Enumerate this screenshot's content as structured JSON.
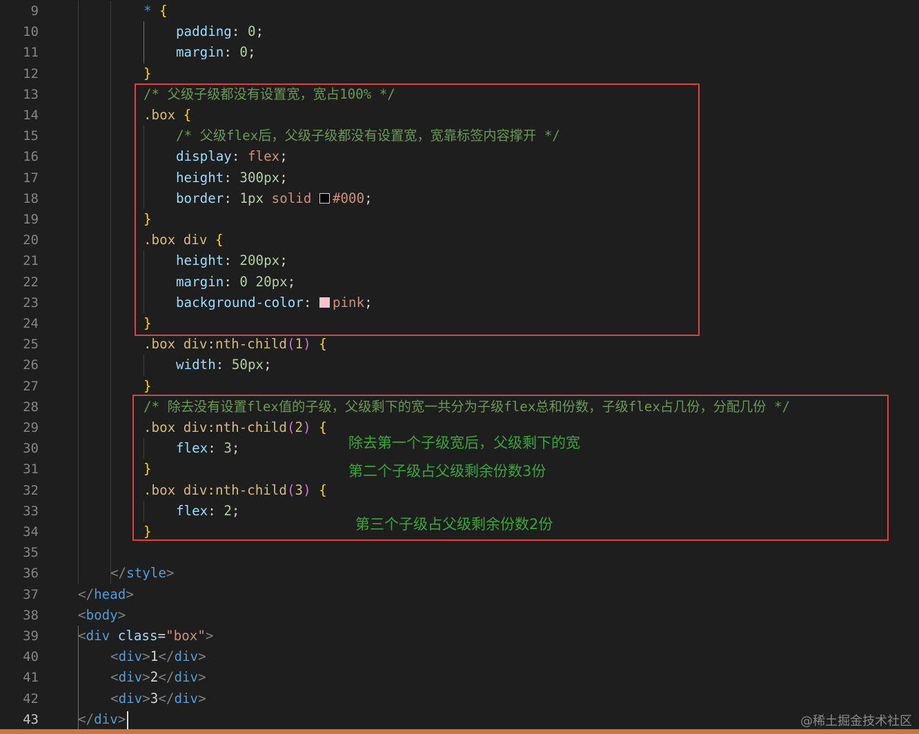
{
  "editor": {
    "active_line": "43",
    "lines": [
      {
        "n": "9",
        "indent": 208,
        "tokens": [
          {
            "t": "* ",
            "c": "star"
          },
          {
            "t": "{",
            "c": "brace"
          }
        ]
      },
      {
        "n": "10",
        "indent": 255,
        "tokens": [
          {
            "t": "padding",
            "c": "prop"
          },
          {
            "t": ": ",
            "c": "plain"
          },
          {
            "t": "0",
            "c": "num"
          },
          {
            "t": ";",
            "c": "plain"
          }
        ]
      },
      {
        "n": "11",
        "indent": 255,
        "tokens": [
          {
            "t": "margin",
            "c": "prop"
          },
          {
            "t": ": ",
            "c": "plain"
          },
          {
            "t": "0",
            "c": "num"
          },
          {
            "t": ";",
            "c": "plain"
          }
        ]
      },
      {
        "n": "12",
        "indent": 208,
        "tokens": [
          {
            "t": "}",
            "c": "brace"
          }
        ]
      },
      {
        "n": "13",
        "indent": 208,
        "tokens": [
          {
            "t": "/* 父级子级都没有设置宽，宽占100% */",
            "c": "cmt"
          }
        ]
      },
      {
        "n": "14",
        "indent": 208,
        "tokens": [
          {
            "t": ".box ",
            "c": "sel"
          },
          {
            "t": "{",
            "c": "brace"
          }
        ]
      },
      {
        "n": "15",
        "indent": 255,
        "tokens": [
          {
            "t": "/* 父级flex后，父级子级都没有设置宽，宽靠标签内容撑开 */",
            "c": "cmt"
          }
        ]
      },
      {
        "n": "16",
        "indent": 255,
        "tokens": [
          {
            "t": "display",
            "c": "prop"
          },
          {
            "t": ": ",
            "c": "plain"
          },
          {
            "t": "flex",
            "c": "val"
          },
          {
            "t": ";",
            "c": "plain"
          }
        ]
      },
      {
        "n": "17",
        "indent": 255,
        "tokens": [
          {
            "t": "height",
            "c": "prop"
          },
          {
            "t": ": ",
            "c": "plain"
          },
          {
            "t": "300px",
            "c": "num"
          },
          {
            "t": ";",
            "c": "plain"
          }
        ]
      },
      {
        "n": "18",
        "indent": 255,
        "tokens": [
          {
            "t": "border",
            "c": "prop"
          },
          {
            "t": ": ",
            "c": "plain"
          },
          {
            "t": "1px ",
            "c": "num"
          },
          {
            "t": "solid ",
            "c": "val"
          },
          {
            "swatch": "#000000"
          },
          {
            "t": "#000",
            "c": "val"
          },
          {
            "t": ";",
            "c": "plain"
          }
        ]
      },
      {
        "n": "19",
        "indent": 208,
        "tokens": [
          {
            "t": "}",
            "c": "brace"
          }
        ]
      },
      {
        "n": "20",
        "indent": 208,
        "tokens": [
          {
            "t": ".box div ",
            "c": "sel"
          },
          {
            "t": "{",
            "c": "brace"
          }
        ]
      },
      {
        "n": "21",
        "indent": 255,
        "tokens": [
          {
            "t": "height",
            "c": "prop"
          },
          {
            "t": ": ",
            "c": "plain"
          },
          {
            "t": "200px",
            "c": "num"
          },
          {
            "t": ";",
            "c": "plain"
          }
        ]
      },
      {
        "n": "22",
        "indent": 255,
        "tokens": [
          {
            "t": "margin",
            "c": "prop"
          },
          {
            "t": ": ",
            "c": "plain"
          },
          {
            "t": "0 20px",
            "c": "num"
          },
          {
            "t": ";",
            "c": "plain"
          }
        ]
      },
      {
        "n": "23",
        "indent": 255,
        "tokens": [
          {
            "t": "background-color",
            "c": "prop"
          },
          {
            "t": ": ",
            "c": "plain"
          },
          {
            "swatch": "#ffc0cb"
          },
          {
            "t": "pink",
            "c": "val"
          },
          {
            "t": ";",
            "c": "plain"
          }
        ]
      },
      {
        "n": "24",
        "indent": 208,
        "tokens": [
          {
            "t": "}",
            "c": "brace"
          }
        ]
      },
      {
        "n": "25",
        "indent": 208,
        "tokens": [
          {
            "t": ".box div:nth-child",
            "c": "sel"
          },
          {
            "t": "(",
            "c": "paren"
          },
          {
            "t": "1",
            "c": "sel"
          },
          {
            "t": ")",
            "c": "paren"
          },
          {
            "t": " ",
            "c": "plain"
          },
          {
            "t": "{",
            "c": "brace"
          }
        ]
      },
      {
        "n": "26",
        "indent": 255,
        "tokens": [
          {
            "t": "width",
            "c": "prop"
          },
          {
            "t": ": ",
            "c": "plain"
          },
          {
            "t": "50px",
            "c": "num"
          },
          {
            "t": ";",
            "c": "plain"
          }
        ]
      },
      {
        "n": "27",
        "indent": 208,
        "tokens": [
          {
            "t": "}",
            "c": "brace"
          }
        ]
      },
      {
        "n": "28",
        "indent": 208,
        "tokens": [
          {
            "t": "/* 除去没有设置flex值的子级，父级剩下的宽一共分为子级flex总和份数，子级flex占几份，分配几份 */",
            "c": "cmt"
          }
        ]
      },
      {
        "n": "29",
        "indent": 208,
        "tokens": [
          {
            "t": ".box div:nth-child",
            "c": "sel"
          },
          {
            "t": "(",
            "c": "paren"
          },
          {
            "t": "2",
            "c": "sel"
          },
          {
            "t": ")",
            "c": "paren"
          },
          {
            "t": " ",
            "c": "plain"
          },
          {
            "t": "{",
            "c": "brace"
          }
        ]
      },
      {
        "n": "30",
        "indent": 255,
        "tokens": [
          {
            "t": "flex",
            "c": "prop"
          },
          {
            "t": ": ",
            "c": "plain"
          },
          {
            "t": "3",
            "c": "num"
          },
          {
            "t": ";",
            "c": "plain"
          }
        ]
      },
      {
        "n": "31",
        "indent": 208,
        "tokens": [
          {
            "t": "}",
            "c": "brace"
          }
        ]
      },
      {
        "n": "32",
        "indent": 208,
        "tokens": [
          {
            "t": ".box div:nth-child",
            "c": "sel"
          },
          {
            "t": "(",
            "c": "paren"
          },
          {
            "t": "3",
            "c": "sel"
          },
          {
            "t": ")",
            "c": "paren"
          },
          {
            "t": " ",
            "c": "plain"
          },
          {
            "t": "{",
            "c": "brace"
          }
        ]
      },
      {
        "n": "33",
        "indent": 255,
        "tokens": [
          {
            "t": "flex",
            "c": "prop"
          },
          {
            "t": ": ",
            "c": "plain"
          },
          {
            "t": "2",
            "c": "num"
          },
          {
            "t": ";",
            "c": "plain"
          }
        ]
      },
      {
        "n": "34",
        "indent": 208,
        "tokens": [
          {
            "t": "}",
            "c": "brace"
          }
        ]
      },
      {
        "n": "35",
        "indent": 208,
        "tokens": []
      },
      {
        "n": "36",
        "indent": 160,
        "tokens": [
          {
            "t": "</",
            "c": "tagp"
          },
          {
            "t": "style",
            "c": "tag"
          },
          {
            "t": ">",
            "c": "tagp"
          }
        ]
      },
      {
        "n": "37",
        "indent": 113,
        "tokens": [
          {
            "t": "</",
            "c": "tagp"
          },
          {
            "t": "head",
            "c": "tag"
          },
          {
            "t": ">",
            "c": "tagp"
          }
        ]
      },
      {
        "n": "38",
        "indent": 113,
        "tokens": [
          {
            "t": "<",
            "c": "tagp"
          },
          {
            "t": "body",
            "c": "tag"
          },
          {
            "t": ">",
            "c": "tagp"
          }
        ]
      },
      {
        "n": "39",
        "indent": 113,
        "tokens": [
          {
            "t": "<",
            "c": "tagp"
          },
          {
            "t": "div ",
            "c": "tag"
          },
          {
            "t": "class",
            "c": "attr"
          },
          {
            "t": "=",
            "c": "plain"
          },
          {
            "t": "\"box\"",
            "c": "str"
          },
          {
            "t": ">",
            "c": "tagp"
          }
        ]
      },
      {
        "n": "40",
        "indent": 160,
        "tokens": [
          {
            "t": "<",
            "c": "tagp"
          },
          {
            "t": "div",
            "c": "tag"
          },
          {
            "t": ">",
            "c": "tagp"
          },
          {
            "t": "1",
            "c": "plain"
          },
          {
            "t": "</",
            "c": "tagp"
          },
          {
            "t": "div",
            "c": "tag"
          },
          {
            "t": ">",
            "c": "tagp"
          }
        ]
      },
      {
        "n": "41",
        "indent": 160,
        "tokens": [
          {
            "t": "<",
            "c": "tagp"
          },
          {
            "t": "div",
            "c": "tag"
          },
          {
            "t": ">",
            "c": "tagp"
          },
          {
            "t": "2",
            "c": "plain"
          },
          {
            "t": "</",
            "c": "tagp"
          },
          {
            "t": "div",
            "c": "tag"
          },
          {
            "t": ">",
            "c": "tagp"
          }
        ]
      },
      {
        "n": "42",
        "indent": 160,
        "tokens": [
          {
            "t": "<",
            "c": "tagp"
          },
          {
            "t": "div",
            "c": "tag"
          },
          {
            "t": ">",
            "c": "tagp"
          },
          {
            "t": "3",
            "c": "plain"
          },
          {
            "t": "</",
            "c": "tagp"
          },
          {
            "t": "div",
            "c": "tag"
          },
          {
            "t": ">",
            "c": "tagp"
          }
        ]
      },
      {
        "n": "43",
        "indent": 113,
        "tokens": [
          {
            "t": "</",
            "c": "tagp"
          },
          {
            "t": "div",
            "c": "tag"
          },
          {
            "t": ">",
            "c": "tagp"
          }
        ]
      }
    ]
  },
  "annotations": {
    "note1": "除去第一个子级宽后，父级剩下的宽",
    "note2": "第二个子级占父级剩余份数3份",
    "note3": "第三个子级占父级剩余份数2份",
    "box_color": "#e04040",
    "note_color": "#3aa63a"
  },
  "watermark": "@稀土掘金技术社区"
}
